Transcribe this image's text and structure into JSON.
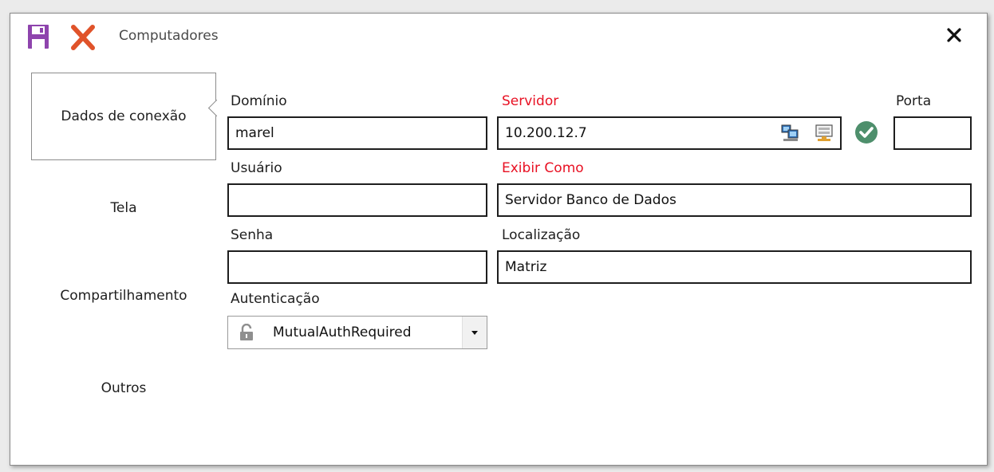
{
  "window": {
    "title": "Computadores"
  },
  "toolbar": {
    "save_icon": "save-icon",
    "cancel_icon": "cancel-icon",
    "close_glyph": "✕"
  },
  "sidebar": {
    "items": [
      {
        "label": "Dados de conexão",
        "active": true
      },
      {
        "label": "Tela",
        "active": false
      },
      {
        "label": "Compartilhamento",
        "active": false
      },
      {
        "label": "Outros",
        "active": false
      }
    ]
  },
  "form": {
    "dominio": {
      "label": "Domínio",
      "value": "marel"
    },
    "servidor": {
      "label": "Servidor",
      "value": "10.200.12.7",
      "required": true
    },
    "porta": {
      "label": "Porta",
      "value": ""
    },
    "usuario": {
      "label": "Usuário",
      "value": ""
    },
    "exibir_como": {
      "label": "Exibir Como",
      "value": "Servidor Banco de Dados",
      "required": true
    },
    "senha": {
      "label": "Senha",
      "value": ""
    },
    "localizacao": {
      "label": "Localização",
      "value": "Matriz"
    },
    "autenticacao": {
      "label": "Autenticação",
      "selected": "MutualAuthRequired",
      "icon": "lock-icon"
    }
  },
  "icons": {
    "network_computers": "network-computers-icon",
    "remote_desktop": "remote-desktop-icon",
    "status_ok": "check-circle-icon"
  },
  "colors": {
    "required_label": "#e81123",
    "save_icon": "#8e44ad",
    "cancel_icon": "#e0532a",
    "status_ok": "#4e8f6c"
  }
}
